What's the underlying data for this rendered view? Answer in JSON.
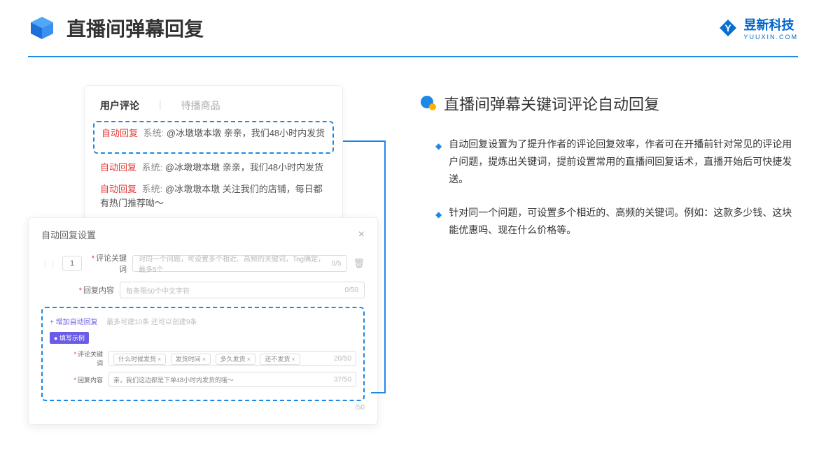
{
  "header": {
    "title": "直播间弹幕回复",
    "logo": "昱新科技",
    "logo_sub": "YUUXIN.COM"
  },
  "tabs": {
    "active": "用户评论",
    "inactive": "待播商品"
  },
  "comments": {
    "c1_tag": "自动回复",
    "c1_sys": "系统:",
    "c1_text": "@冰墩墩本墩 亲亲，我们48小时内发货",
    "c2_tag": "自动回复",
    "c2_sys": "系统:",
    "c2_text": "@冰墩墩本墩 亲亲，我们48小时内发货",
    "c3_tag": "自动回复",
    "c3_sys": "系统:",
    "c3_text": "@冰墩墩本墩 关注我们的店铺，每日都有热门推荐呦～"
  },
  "panel": {
    "title": "自动回复设置",
    "num": "1",
    "kw_label": "评论关键词",
    "kw_ph": "对同一个问题，可设置多个相近、高频的关键词，Tag确定，最多5个",
    "kw_cnt": "0/5",
    "ct_label": "回复内容",
    "ct_ph": "每条限50个中文字符",
    "ct_cnt": "0/50",
    "add": "+ 增加自动回复",
    "add_hint": "最多可建10条 还可以创建9条",
    "ex_badge": "● 填写示例",
    "ex_kw_label": "评论关键词",
    "chip1": "什么时候发货",
    "chip2": "发货时间",
    "chip3": "多久发货",
    "chip4": "还不发货",
    "ex_kw_cnt": "20/50",
    "ex_ct_label": "回复内容",
    "ex_ct_text": "亲，我们这边都是下单48小时内发货的哦～",
    "ex_ct_cnt": "37/50",
    "tail_cnt": "/50"
  },
  "right": {
    "title": "直播间弹幕关键词评论自动回复",
    "b1": "自动回复设置为了提升作者的评论回复效率，作者可在开播前针对常见的评论用户问题，提炼出关键词，提前设置常用的直播间回复话术，直播开始后可快捷发送。",
    "b2": "针对同一个问题，可设置多个相近的、高频的关键词。例如：这款多少钱、这块能优惠吗、现在什么价格等。"
  }
}
